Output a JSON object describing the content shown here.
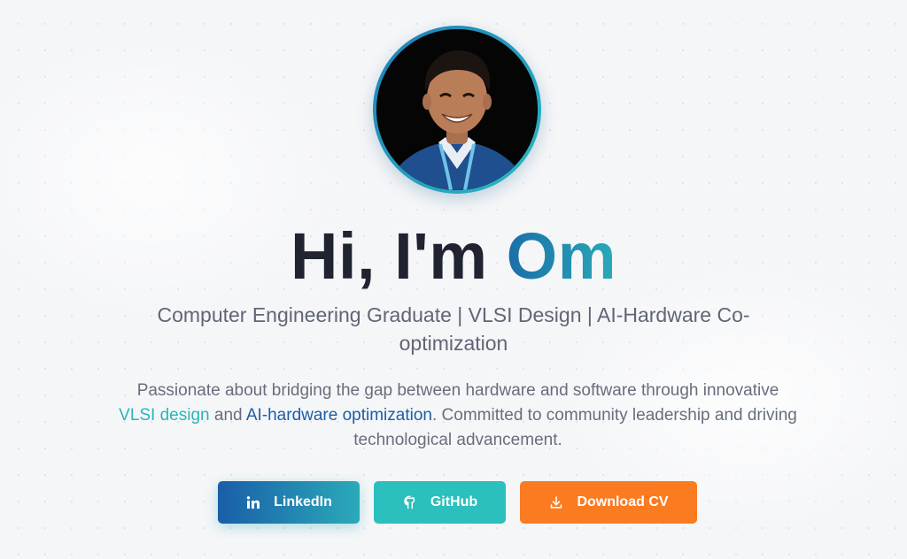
{
  "hero": {
    "greeting": "Hi, I'm ",
    "name": "Om",
    "subtitle_line1": "Computer Engineering Graduate | VLSI Design | AI-Hardware Co-",
    "subtitle_line2": "optimization",
    "desc_part1": "Passionate about bridging the gap between hardware and software through innovative ",
    "desc_highlight1": "VLSI design",
    "desc_part2": " and ",
    "desc_highlight2": "AI-hardware optimization",
    "desc_part3": ". Committed to community leadership and driving technological advancement."
  },
  "buttons": {
    "linkedin": {
      "label": "LinkedIn",
      "icon": "linkedin-icon"
    },
    "github": {
      "label": "GitHub",
      "icon": "github-icon"
    },
    "cv": {
      "label": "Download CV",
      "icon": "download-icon"
    }
  },
  "colors": {
    "accent_blue": "#1c5ea6",
    "accent_teal": "#2ab5b8",
    "cv_orange": "#fb7b21",
    "title_dark": "#1f2430"
  }
}
